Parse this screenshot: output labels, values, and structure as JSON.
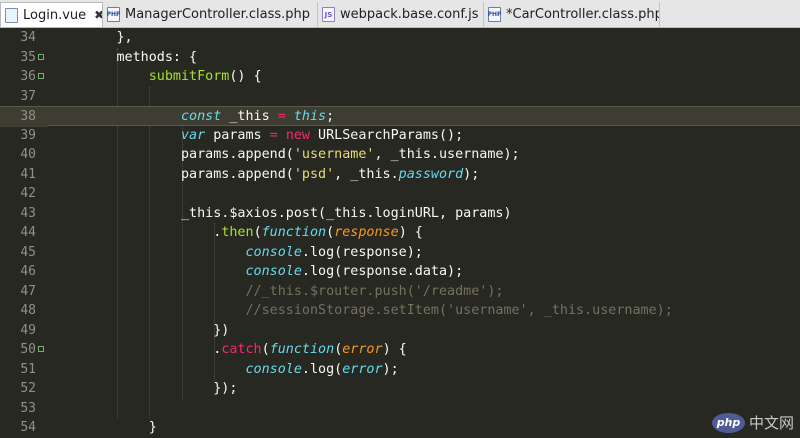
{
  "tabs": [
    {
      "label": "Login.vue",
      "icon": "vue-file-icon",
      "active": true,
      "closable": true
    },
    {
      "label": "ManagerController.class.php",
      "icon": "php-file-icon",
      "active": false
    },
    {
      "label": "webpack.base.conf.js",
      "icon": "js-file-icon",
      "active": false
    },
    {
      "label": "*CarController.class.php",
      "icon": "php-file-icon",
      "active": false
    }
  ],
  "icon_text": {
    "php": "PHP",
    "js": "JS"
  },
  "close_glyph": "✖",
  "highlighted_line": 38,
  "lines": [
    {
      "n": "34",
      "tokens": [
        {
          "t": "        },",
          "c": ""
        }
      ]
    },
    {
      "n": "35",
      "fold": true,
      "tokens": [
        {
          "t": "        methods: {",
          "c": ""
        }
      ]
    },
    {
      "n": "36",
      "fold": true,
      "tokens": [
        {
          "t": "            ",
          "c": ""
        },
        {
          "t": "submitForm",
          "c": "fn"
        },
        {
          "t": "() {",
          "c": ""
        }
      ]
    },
    {
      "n": "37",
      "tokens": []
    },
    {
      "n": "38",
      "tokens": [
        {
          "t": "                ",
          "c": ""
        },
        {
          "t": "const",
          "c": "ki"
        },
        {
          "t": " _this ",
          "c": ""
        },
        {
          "t": "=",
          "c": "kw"
        },
        {
          "t": " ",
          "c": ""
        },
        {
          "t": "this",
          "c": "ki"
        },
        {
          "t": ";",
          "c": ""
        }
      ]
    },
    {
      "n": "39",
      "tokens": [
        {
          "t": "                ",
          "c": ""
        },
        {
          "t": "var",
          "c": "ki"
        },
        {
          "t": " params ",
          "c": ""
        },
        {
          "t": "=",
          "c": "kw"
        },
        {
          "t": " ",
          "c": ""
        },
        {
          "t": "new",
          "c": "kw"
        },
        {
          "t": " URLSearchParams();",
          "c": ""
        }
      ]
    },
    {
      "n": "40",
      "tokens": [
        {
          "t": "                params.append(",
          "c": ""
        },
        {
          "t": "'username'",
          "c": "st"
        },
        {
          "t": ", _this.username);",
          "c": ""
        }
      ]
    },
    {
      "n": "41",
      "tokens": [
        {
          "t": "                params.append(",
          "c": ""
        },
        {
          "t": "'psd'",
          "c": "st"
        },
        {
          "t": ", _this.",
          "c": ""
        },
        {
          "t": "password",
          "c": "ki"
        },
        {
          "t": ");",
          "c": ""
        }
      ]
    },
    {
      "n": "42",
      "tokens": []
    },
    {
      "n": "43",
      "tokens": [
        {
          "t": "                _this.$axios.post(_this.loginURL, params)",
          "c": ""
        }
      ]
    },
    {
      "n": "44",
      "tokens": [
        {
          "t": "                    .",
          "c": ""
        },
        {
          "t": "then",
          "c": "fn"
        },
        {
          "t": "(",
          "c": ""
        },
        {
          "t": "function",
          "c": "ki"
        },
        {
          "t": "(",
          "c": ""
        },
        {
          "t": "response",
          "c": "pr"
        },
        {
          "t": ") {",
          "c": ""
        }
      ]
    },
    {
      "n": "45",
      "tokens": [
        {
          "t": "                        ",
          "c": ""
        },
        {
          "t": "console",
          "c": "ki"
        },
        {
          "t": ".log(response);",
          "c": ""
        }
      ]
    },
    {
      "n": "46",
      "tokens": [
        {
          "t": "                        ",
          "c": ""
        },
        {
          "t": "console",
          "c": "ki"
        },
        {
          "t": ".log(response.data);",
          "c": ""
        }
      ]
    },
    {
      "n": "47",
      "tokens": [
        {
          "t": "                        ",
          "c": ""
        },
        {
          "t": "//_this.$router.push('/readme');",
          "c": "cm"
        }
      ]
    },
    {
      "n": "48",
      "tokens": [
        {
          "t": "                        ",
          "c": ""
        },
        {
          "t": "//sessionStorage.setItem('username', _this.username);",
          "c": "cm"
        }
      ]
    },
    {
      "n": "49",
      "tokens": [
        {
          "t": "                    })",
          "c": ""
        }
      ]
    },
    {
      "n": "50",
      "fold": true,
      "tokens": [
        {
          "t": "                    .",
          "c": ""
        },
        {
          "t": "catch",
          "c": "kw"
        },
        {
          "t": "(",
          "c": ""
        },
        {
          "t": "function",
          "c": "ki"
        },
        {
          "t": "(",
          "c": ""
        },
        {
          "t": "error",
          "c": "pr"
        },
        {
          "t": ") {",
          "c": ""
        }
      ]
    },
    {
      "n": "51",
      "tokens": [
        {
          "t": "                        ",
          "c": ""
        },
        {
          "t": "console",
          "c": "ki"
        },
        {
          "t": ".log(",
          "c": ""
        },
        {
          "t": "error",
          "c": "ki"
        },
        {
          "t": ");",
          "c": ""
        }
      ]
    },
    {
      "n": "52",
      "tokens": [
        {
          "t": "                    });",
          "c": ""
        }
      ]
    },
    {
      "n": "53",
      "tokens": []
    },
    {
      "n": "54",
      "tokens": [
        {
          "t": "            }",
          "c": ""
        }
      ]
    }
  ],
  "watermark": {
    "logo_text": "php",
    "text": "中文网"
  }
}
